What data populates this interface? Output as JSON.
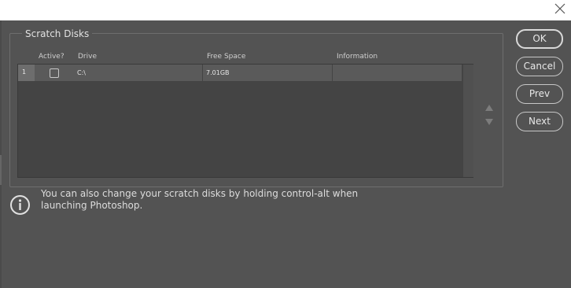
{
  "dialog": {
    "close_icon": "close-icon"
  },
  "scratch": {
    "group_title": "Scratch Disks",
    "columns": {
      "active": "Active?",
      "drive": "Drive",
      "free_space": "Free Space",
      "information": "Information"
    },
    "rows": [
      {
        "index": "1",
        "active": false,
        "drive": "C:\\",
        "free_space": "7.01GB",
        "information": ""
      }
    ],
    "move_up_icon": "triangle-up-icon",
    "move_down_icon": "triangle-down-icon"
  },
  "buttons": {
    "ok": "OK",
    "cancel": "Cancel",
    "prev": "Prev",
    "next": "Next"
  },
  "info": {
    "icon": "info-icon",
    "text": "You can also change your scratch disks by holding control-alt when launching Photoshop."
  },
  "colors": {
    "background": "#535353",
    "table_background": "#444444",
    "row_selected": "#5a5a5a"
  }
}
